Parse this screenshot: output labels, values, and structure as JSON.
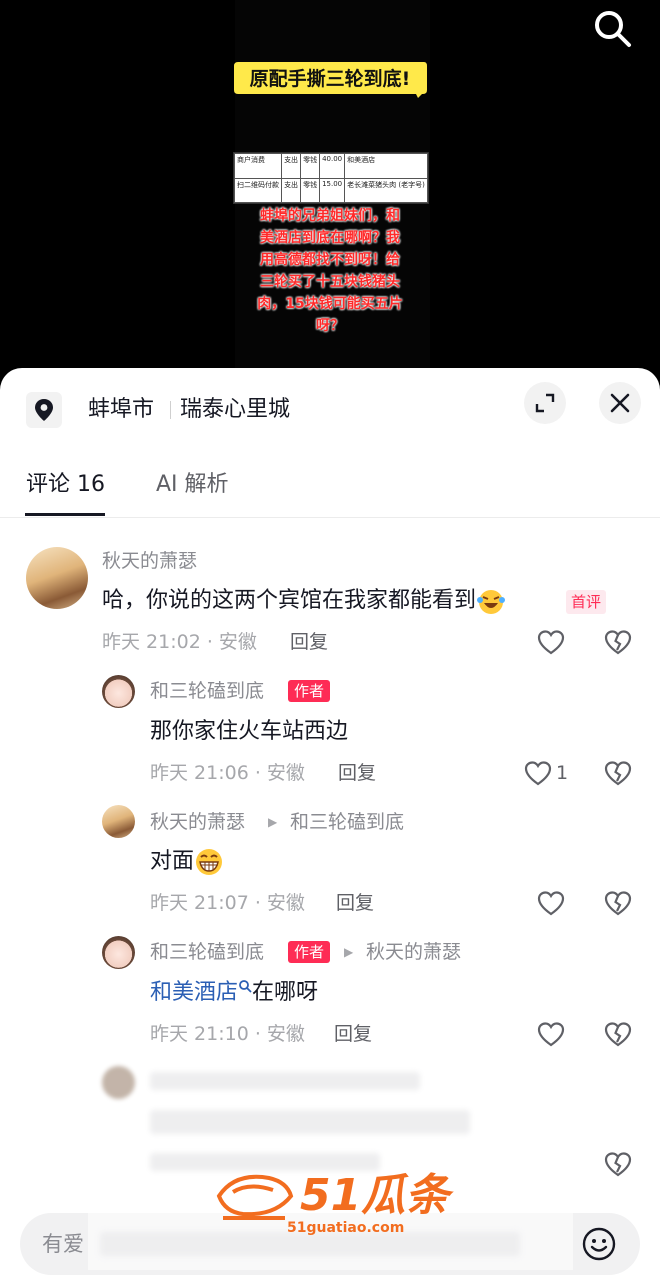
{
  "video": {
    "bubble_text": "原配手撕三轮到底!",
    "receipt_rows": [
      [
        "商户消费",
        "支出",
        "零钱",
        "40.00",
        "和美酒店"
      ],
      [
        "扫二维码付款",
        "支出",
        "零钱",
        "15.00",
        "老长滩菜猪头肉 (老字号)"
      ]
    ],
    "overlay_lines": [
      "蚌埠的兄弟姐妹们，和",
      "美酒店到底在哪啊？我",
      "用高德都找不到呀！给",
      "三轮买了十五块钱猪头",
      "肉，15块钱可能买五片",
      "呀？"
    ]
  },
  "location": {
    "city": "蚌埠市",
    "place": "瑞泰心里城"
  },
  "tabs": [
    {
      "label": "评论 16",
      "active": true
    },
    {
      "label": "AI 解析",
      "active": false
    }
  ],
  "comments": [
    {
      "user": "秋天的萧瑟",
      "text": "哈，你说的这两个宾馆在我家都能看到",
      "badge": "首评",
      "meta": "昨天 21:02 · 安徽",
      "reply": "回复"
    },
    {
      "user": "和三轮磕到底",
      "badge": "作者",
      "text": "那你家住火车站西边",
      "meta": "昨天 21:06 · 安徽",
      "reply": "回复",
      "likes": "1"
    },
    {
      "user": "秋天的萧瑟",
      "reply_to": "和三轮磕到底",
      "text": "对面",
      "meta": "昨天 21:07 · 安徽",
      "reply": "回复"
    },
    {
      "user": "和三轮磕到底",
      "badge": "作者",
      "reply_to": "秋天的萧瑟",
      "text_link": "和美酒店",
      "text": "在哪呀",
      "meta": "昨天 21:10 · 安徽",
      "reply": "回复"
    }
  ],
  "watermark": {
    "brand": "51瓜条",
    "site": "51guatiao.com"
  },
  "input": {
    "placeholder": "有爱"
  },
  "colors": {
    "accent": "#fe2c55",
    "link": "#2b5fb4",
    "watermark": "#f26d1f"
  },
  "icons": [
    "search-icon",
    "location-icon",
    "expand-icon",
    "close-icon",
    "heart-icon",
    "broken-heart-icon",
    "emoji-icon"
  ]
}
